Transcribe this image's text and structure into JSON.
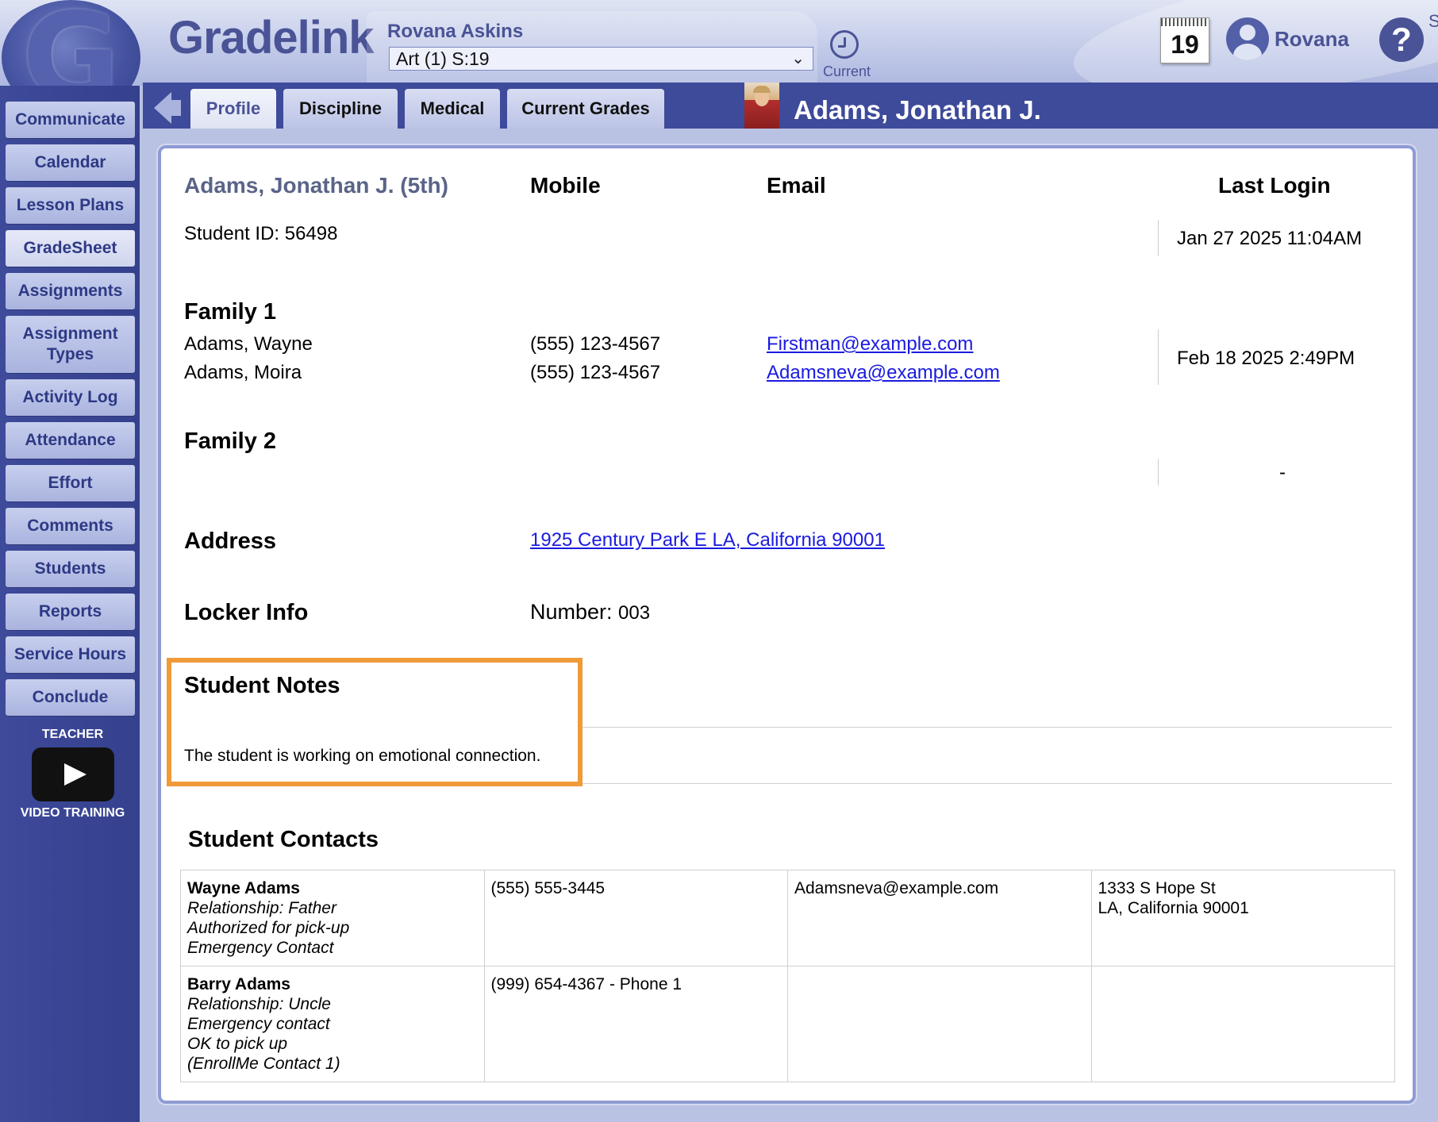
{
  "header": {
    "brand": "Gradelink",
    "logo_letter": "G",
    "teacher_name": "Rovana Askins",
    "class_select_value": "Art (1)  S:19",
    "current_label": "Current",
    "calendar_day": "19",
    "user_name": "Rovana",
    "help_glyph": "?",
    "edge_letter": "S",
    "icons": [
      "clock-icon",
      "calendar-icon",
      "user-icon",
      "help-icon",
      "chevron-down-icon"
    ]
  },
  "sidebar": {
    "items": [
      {
        "label": "Communicate"
      },
      {
        "label": "Calendar"
      },
      {
        "label": "Lesson Plans"
      },
      {
        "label": "GradeSheet"
      },
      {
        "label": "Assignments"
      },
      {
        "label": "Assignment Types"
      },
      {
        "label": "Activity Log"
      },
      {
        "label": "Attendance"
      },
      {
        "label": "Effort"
      },
      {
        "label": "Comments"
      },
      {
        "label": "Students"
      },
      {
        "label": "Reports"
      },
      {
        "label": "Service Hours"
      },
      {
        "label": "Conclude"
      }
    ],
    "active_item": "GradeSheet",
    "teacher_label": "TEACHER",
    "video_label": "VIDEO TRAINING"
  },
  "tabs": {
    "items": [
      {
        "label": "Profile"
      },
      {
        "label": "Discipline"
      },
      {
        "label": "Medical"
      },
      {
        "label": "Current Grades"
      }
    ],
    "active": "Profile",
    "student_title": "Adams, Jonathan J."
  },
  "profile": {
    "student_heading": "Adams, Jonathan J. (5th)",
    "col_mobile": "Mobile",
    "col_email": "Email",
    "col_last_login": "Last Login",
    "student_id": "Student ID: 56498",
    "student_last_login": "Jan 27 2025 11:04AM",
    "family1": {
      "heading": "Family 1",
      "members": [
        {
          "name": "Adams, Wayne",
          "mobile": "(555) 123-4567",
          "email": "Firstman@example.com"
        },
        {
          "name": "Adams, Moira",
          "mobile": "(555) 123-4567",
          "email": "Adamsneva@example.com"
        }
      ],
      "last_login": "Feb 18 2025 2:49PM"
    },
    "family2": {
      "heading": "Family 2",
      "last_login": "-"
    },
    "address": {
      "heading": "Address",
      "value": "1925 Century Park E  LA, California  90001"
    },
    "locker": {
      "heading": "Locker Info",
      "label": "Number:",
      "value": "003"
    },
    "notes": {
      "heading": "Student Notes",
      "text": "The student is working on emotional connection."
    },
    "contacts": {
      "heading": "Student Contacts",
      "rows": [
        {
          "name": "Wayne Adams",
          "details": [
            "Relationship: Father",
            "Authorized for pick-up",
            "Emergency Contact"
          ],
          "phone": "(555) 555-3445",
          "email": "Adamsneva@example.com",
          "address": [
            "1333 S Hope St",
            "LA, California 90001"
          ]
        },
        {
          "name": "Barry Adams",
          "details": [
            "Relationship: Uncle",
            "Emergency contact",
            "OK to pick up",
            "(EnrollMe Contact 1)"
          ],
          "phone": "(999) 654-4367 - Phone 1",
          "email": "",
          "address": [
            "",
            ""
          ]
        }
      ]
    }
  },
  "colors": {
    "sidebar_bg": "#3e4a9a",
    "nav_text": "#2e3985",
    "link": "#1a1ae0",
    "highlight_border": "#f09a38",
    "panel_border": "#8f9bd4"
  }
}
